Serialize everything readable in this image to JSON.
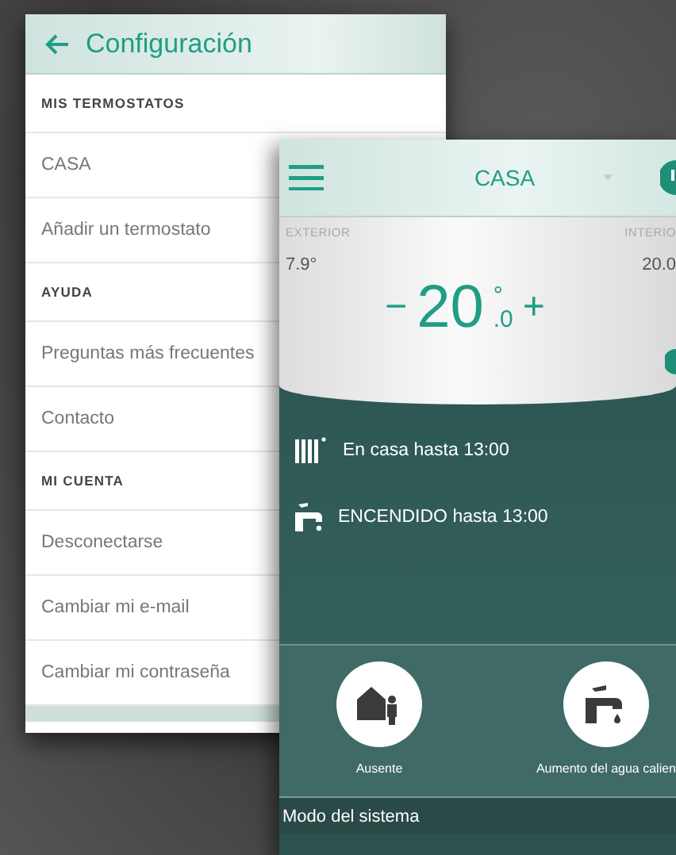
{
  "settings_screen": {
    "title": "Configuración",
    "items": [
      {
        "kind": "header",
        "label": "MIS TERMOSTATOS"
      },
      {
        "kind": "item",
        "label": "CASA"
      },
      {
        "kind": "item",
        "label": "Añadir un termostato"
      },
      {
        "kind": "header",
        "label": "AYUDA"
      },
      {
        "kind": "item",
        "label": "Preguntas más frecuentes"
      },
      {
        "kind": "item",
        "label": "Contacto"
      },
      {
        "kind": "header",
        "label": "MI CUENTA"
      },
      {
        "kind": "item",
        "label": "Desconectarse"
      },
      {
        "kind": "item",
        "label": "Cambiar mi e-mail"
      },
      {
        "kind": "item",
        "label": "Cambiar mi contraseña"
      }
    ]
  },
  "thermostat_screen": {
    "title": "CASA",
    "exterior": {
      "label": "EXTERIOR",
      "value": "7.9°"
    },
    "interior": {
      "label": "INTERIO",
      "value": "20.0"
    },
    "setpoint": {
      "minus": "−",
      "integer": "20",
      "degree": "°",
      "decimal": ".0",
      "plus": "+"
    },
    "statuses": [
      {
        "kind": "heating",
        "text": "En casa hasta 13:00"
      },
      {
        "kind": "water",
        "text": "ENCENDIDO hasta 13:00"
      }
    ],
    "actions": [
      {
        "kind": "away",
        "label": "Ausente"
      },
      {
        "kind": "water",
        "label": "Aumento del agua calien"
      }
    ],
    "footer": "Modo del sistema"
  }
}
